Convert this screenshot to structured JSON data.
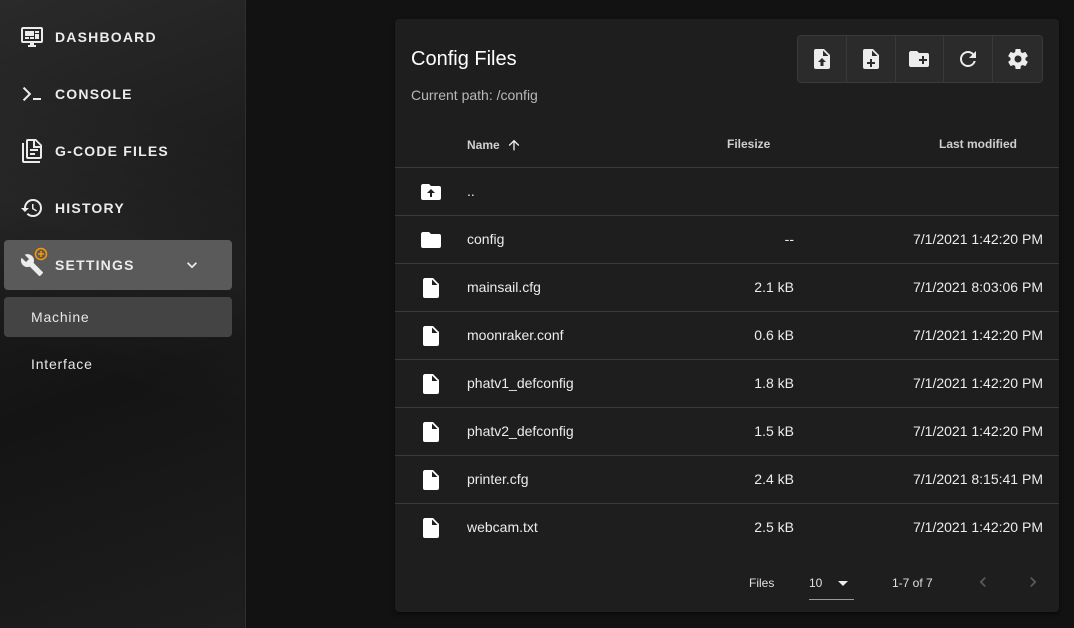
{
  "sidebar": {
    "items": [
      {
        "label": "DASHBOARD",
        "icon": "monitor-dashboard-icon"
      },
      {
        "label": "CONSOLE",
        "icon": "console-icon"
      },
      {
        "label": "G-CODE FILES",
        "icon": "file-document-icon"
      },
      {
        "label": "HISTORY",
        "icon": "history-icon"
      },
      {
        "label": "SETTINGS",
        "icon": "wrench-icon",
        "active": true
      }
    ],
    "settings_sub": [
      {
        "label": "Machine",
        "active": true
      },
      {
        "label": "Interface"
      }
    ],
    "accent_color": "#ff9800"
  },
  "card": {
    "title": "Config Files",
    "current_path": "Current path: /config",
    "toolbar": [
      {
        "icon": "file-upload-icon"
      },
      {
        "icon": "file-plus-icon"
      },
      {
        "icon": "folder-plus-icon"
      },
      {
        "icon": "refresh-icon"
      },
      {
        "icon": "settings-gear-icon"
      }
    ]
  },
  "table": {
    "headers": {
      "name": "Name",
      "size": "Filesize",
      "modified": "Last modified"
    },
    "sort_icon": "arrow-up-icon",
    "rows": [
      {
        "type": "up",
        "name": "..",
        "size": "",
        "modified": ""
      },
      {
        "type": "folder",
        "name": "config",
        "size": "--",
        "modified": "7/1/2021 1:42:20 PM"
      },
      {
        "type": "file",
        "name": "mainsail.cfg",
        "size": "2.1 kB",
        "modified": "7/1/2021 8:03:06 PM"
      },
      {
        "type": "file",
        "name": "moonraker.conf",
        "size": "0.6 kB",
        "modified": "7/1/2021 1:42:20 PM"
      },
      {
        "type": "file",
        "name": "phatv1_defconfig",
        "size": "1.8 kB",
        "modified": "7/1/2021 1:42:20 PM"
      },
      {
        "type": "file",
        "name": "phatv2_defconfig",
        "size": "1.5 kB",
        "modified": "7/1/2021 1:42:20 PM"
      },
      {
        "type": "file",
        "name": "printer.cfg",
        "size": "2.4 kB",
        "modified": "7/1/2021 8:15:41 PM"
      },
      {
        "type": "file",
        "name": "webcam.txt",
        "size": "2.5 kB",
        "modified": "7/1/2021 1:42:20 PM"
      }
    ]
  },
  "footer": {
    "per_page_label": "Files",
    "per_page_value": "10",
    "range": "1-7 of 7"
  }
}
